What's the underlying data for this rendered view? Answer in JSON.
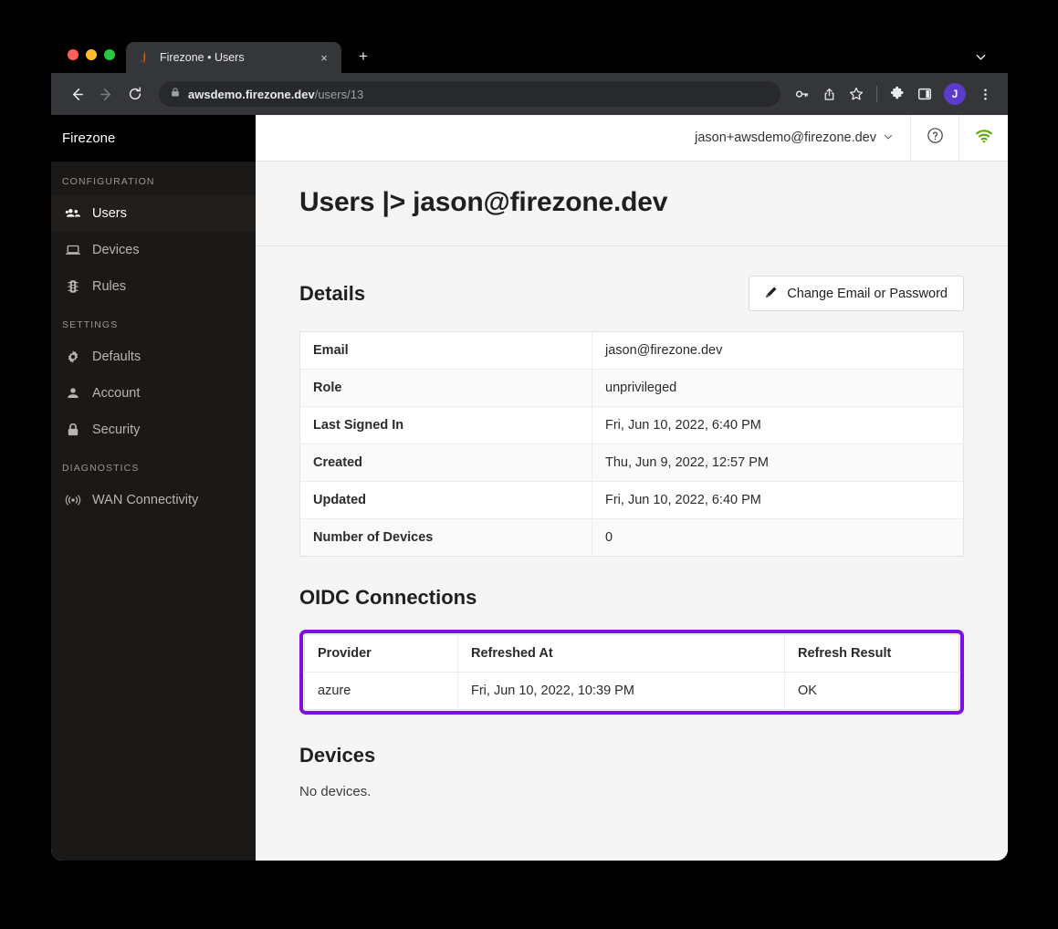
{
  "browser": {
    "tab": {
      "title": "Firezone • Users",
      "favicon": "firezone-flame-icon",
      "close": "×"
    },
    "new_tab_label": "+",
    "window_chevron": "⌄",
    "nav": {
      "back": "←",
      "forward": "→",
      "reload": "⟳"
    },
    "omnibox": {
      "lock": "lock-icon",
      "domain": "awsdemo.firezone.dev",
      "path": "/users/13"
    },
    "toolbar_icons": [
      "key-icon",
      "share-icon",
      "bookmark-star-icon",
      "extensions-puzzle-icon",
      "side-panel-icon"
    ],
    "avatar_initial": "J",
    "menu": "⋮"
  },
  "sidebar": {
    "brand": "Firezone",
    "sections": [
      {
        "label": "CONFIGURATION",
        "items": [
          {
            "label": "Users",
            "icon": "users-group-icon",
            "active": true
          },
          {
            "label": "Devices",
            "icon": "laptop-icon",
            "active": false
          },
          {
            "label": "Rules",
            "icon": "traffic-light-icon",
            "active": false
          }
        ]
      },
      {
        "label": "SETTINGS",
        "items": [
          {
            "label": "Defaults",
            "icon": "gear-icon",
            "active": false
          },
          {
            "label": "Account",
            "icon": "person-icon",
            "active": false
          },
          {
            "label": "Security",
            "icon": "lock-icon",
            "active": false
          }
        ]
      },
      {
        "label": "DIAGNOSTICS",
        "items": [
          {
            "label": "WAN Connectivity",
            "icon": "broadcast-icon",
            "active": false
          }
        ]
      }
    ]
  },
  "header": {
    "account_email": "jason+awsdemo@firezone.dev",
    "chevron": "⌄",
    "help_icon": "help-circle-icon",
    "status_icon": "wifi-icon",
    "status_color": "#5aa700"
  },
  "page": {
    "title": "Users |> jason@firezone.dev"
  },
  "details": {
    "heading": "Details",
    "action_button": {
      "label": "Change Email or Password",
      "icon": "pencil-icon"
    },
    "rows": [
      {
        "key": "Email",
        "value": "jason@firezone.dev"
      },
      {
        "key": "Role",
        "value": "unprivileged"
      },
      {
        "key": "Last Signed In",
        "value": "Fri, Jun 10, 2022, 6:40 PM"
      },
      {
        "key": "Created",
        "value": "Thu, Jun 9, 2022, 12:57 PM"
      },
      {
        "key": "Updated",
        "value": "Fri, Jun 10, 2022, 6:40 PM"
      },
      {
        "key": "Number of Devices",
        "value": "0"
      }
    ]
  },
  "oidc": {
    "heading": "OIDC Connections",
    "highlight_color": "#7b10e0",
    "columns": [
      "Provider",
      "Refreshed At",
      "Refresh Result"
    ],
    "rows": [
      {
        "provider": "azure",
        "refreshed_at": "Fri, Jun 10, 2022, 10:39 PM",
        "result": "OK"
      }
    ]
  },
  "devices": {
    "heading": "Devices",
    "empty_text": "No devices."
  }
}
